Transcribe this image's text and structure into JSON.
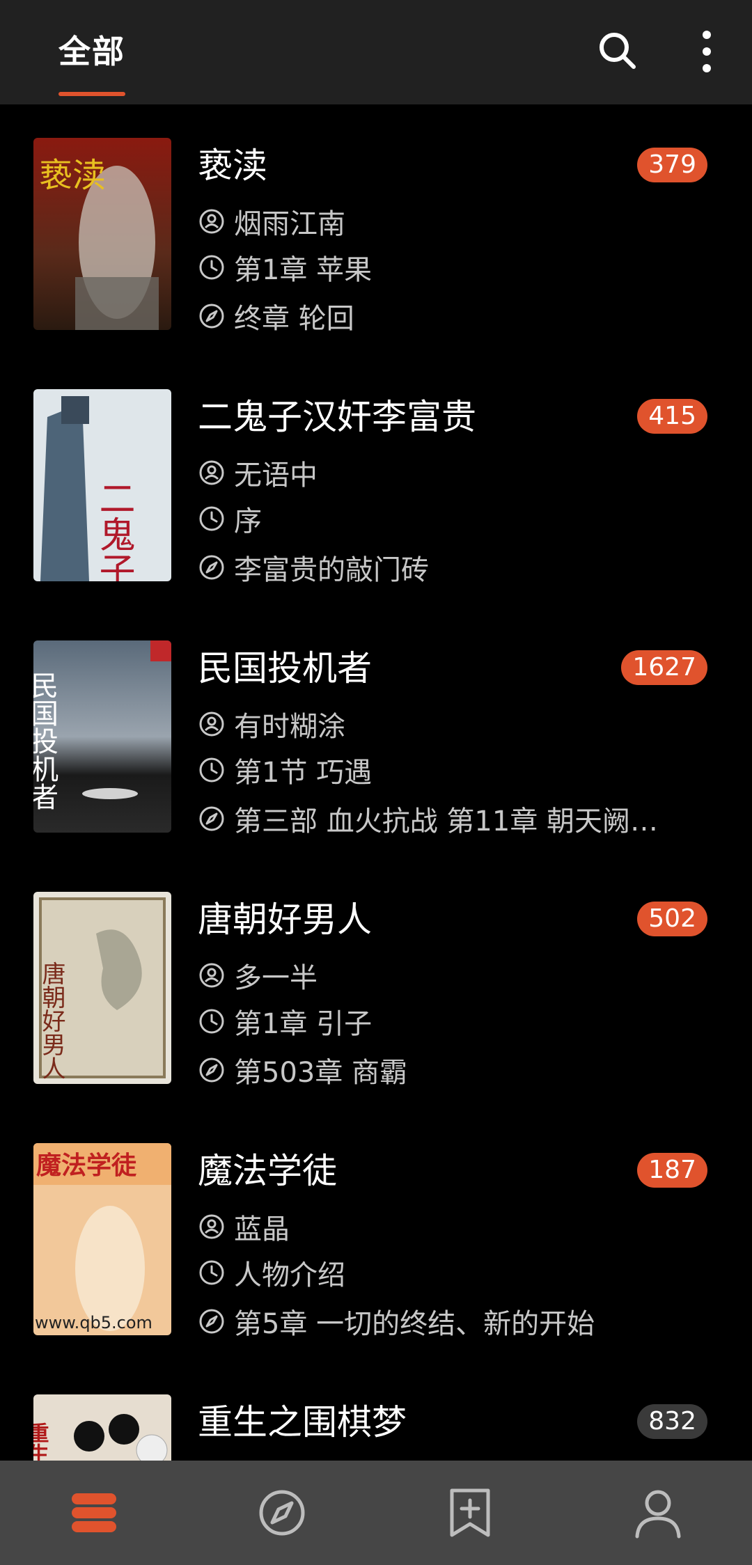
{
  "header": {
    "tab_label": "全部",
    "search_icon": "search-icon",
    "more_icon": "more-vertical-icon"
  },
  "accent_color": "#e0532d",
  "books": [
    {
      "title": "亵渎",
      "count": "379",
      "author": "烟雨江南",
      "last_read": "第1章 苹果",
      "latest": "终章 轮回",
      "badge_style": "accent"
    },
    {
      "title": "二鬼子汉奸李富贵",
      "count": "415",
      "author": "无语中",
      "last_read": "序",
      "latest": "李富贵的敲门砖",
      "badge_style": "accent"
    },
    {
      "title": "民国投机者",
      "count": "1627",
      "author": "有时糊涂",
      "last_read": "第1节 巧遇",
      "latest": "第三部 血火抗战 第11章 朝天阙…",
      "badge_style": "accent"
    },
    {
      "title": "唐朝好男人",
      "count": "502",
      "author": "多一半",
      "last_read": "第1章 引子",
      "latest": "第503章 商霸",
      "badge_style": "accent"
    },
    {
      "title": "魔法学徒",
      "count": "187",
      "author": "蓝晶",
      "last_read": "人物介绍",
      "latest": "第5章 一切的终结、新的开始",
      "badge_style": "accent"
    },
    {
      "title": "重生之围棋梦",
      "count": "832",
      "author": "",
      "last_read": "",
      "latest": "",
      "badge_style": "gray"
    }
  ],
  "covers": [
    {
      "cover_text": "亵渎"
    },
    {
      "cover_text": "二鬼子"
    },
    {
      "cover_text": "民国投机者"
    },
    {
      "cover_text": "唐朝好男人"
    },
    {
      "cover_text": "魔法学徒",
      "cover_footer": "www.qb5.com"
    },
    {
      "cover_text": "重生之"
    }
  ],
  "bottom_nav": [
    {
      "icon": "bookshelf-icon",
      "active": true
    },
    {
      "icon": "discover-compass-icon",
      "active": false
    },
    {
      "icon": "bookmark-add-icon",
      "active": false
    },
    {
      "icon": "profile-icon",
      "active": false
    }
  ]
}
